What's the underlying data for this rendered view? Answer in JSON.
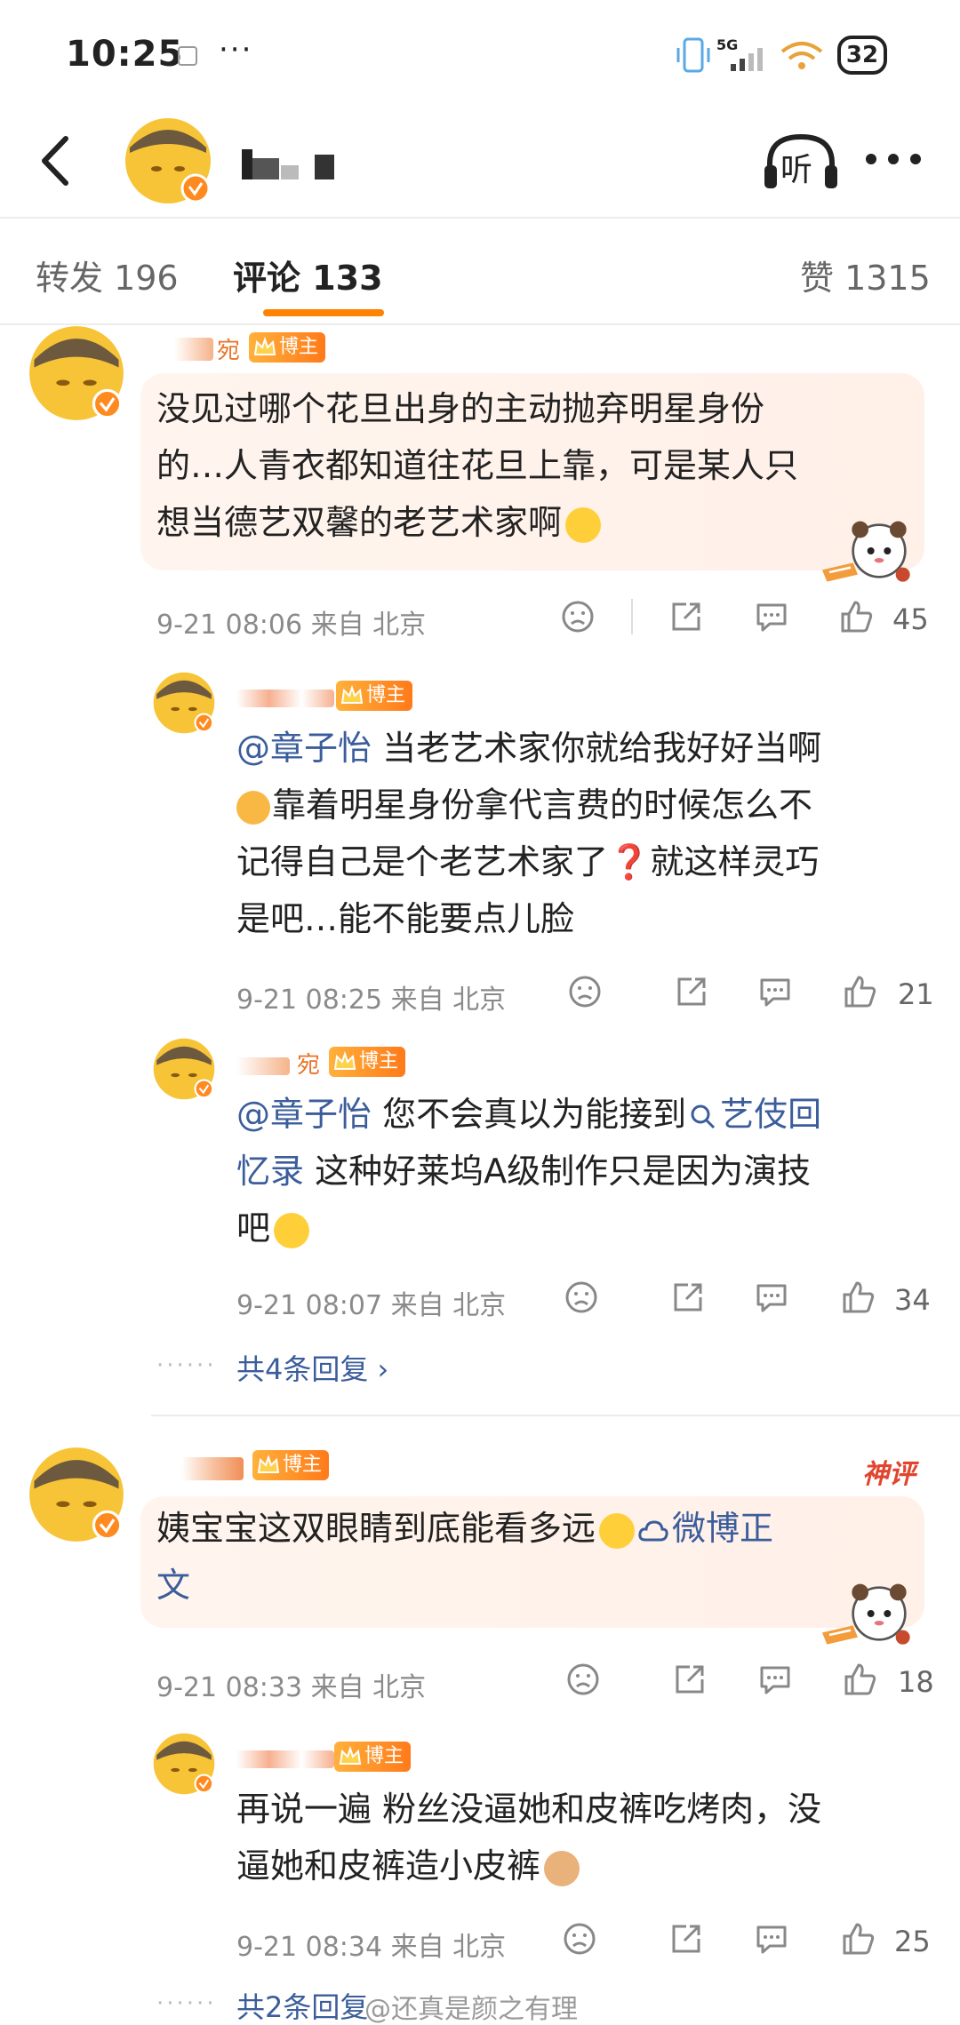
{
  "status_bar": {
    "time": "10:25",
    "dots": "···",
    "network": "5G",
    "battery": "32"
  },
  "nav": {
    "listen_label": "听"
  },
  "tabs": {
    "repost": "转发 196",
    "comments": "评论 133",
    "likes": "赞 1315"
  },
  "badges": {
    "blogger": "博主"
  },
  "comments": [
    {
      "text": "没见过哪个花旦出身的主动抛弃明星身份的…人青衣都知道往花旦上靠，可是某人只想当德艺双馨的老艺术家啊",
      "lines": [
        "没见过哪个花旦出身的主动抛弃明星身份",
        "的…人青衣都知道往花旦上靠，可是某人只",
        "想当德艺双馨的老艺术家啊"
      ],
      "time": "9-21 08:06",
      "source": "来自 北京",
      "likes": "45",
      "name_suffix": "宛",
      "replies": [
        {
          "mention": "@章子怡",
          "lines_after_mention": " 当老艺术家你就给我好好当啊",
          "lines": [
            "靠着明星身份拿代言费的时候怎么不",
            "记得自己是个老艺术家了❓就这样灵巧",
            "是吧…能不能要点儿脸"
          ],
          "time": "9-21 08:25",
          "source": "来自 北京",
          "likes": "21"
        },
        {
          "mention": "@章子怡",
          "line1_rest": " 您不会真以为能接到",
          "link": "艺伎回",
          "link2": "忆录",
          "line2_rest": " 这种好莱坞A级制作只是因为演技",
          "line3": "吧",
          "time": "9-21 08:07",
          "source": "来自 北京",
          "likes": "34",
          "name_suffix": "宛"
        }
      ],
      "more_replies": "共4条回复 ›"
    },
    {
      "tag": "神评",
      "line1": "姨宝宝这双眼睛到底能看多远",
      "link": "微博正",
      "link2": "文",
      "time": "9-21 08:33",
      "source": "来自 北京",
      "likes": "18",
      "replies": [
        {
          "lines": [
            "再说一遍 粉丝没逼她和皮裤吃烤肉，没",
            "逼她和皮裤造小皮裤"
          ],
          "time": "9-21 08:34",
          "source": "来自 北京",
          "likes": "25"
        }
      ],
      "more_replies": "共2条回复"
    }
  ],
  "watermark": "@还真是颜之有理",
  "colors": {
    "accent": "#ff8200",
    "link": "#3b5d9b",
    "badge": "#ff8a1f",
    "shenping": "#e0452e"
  }
}
